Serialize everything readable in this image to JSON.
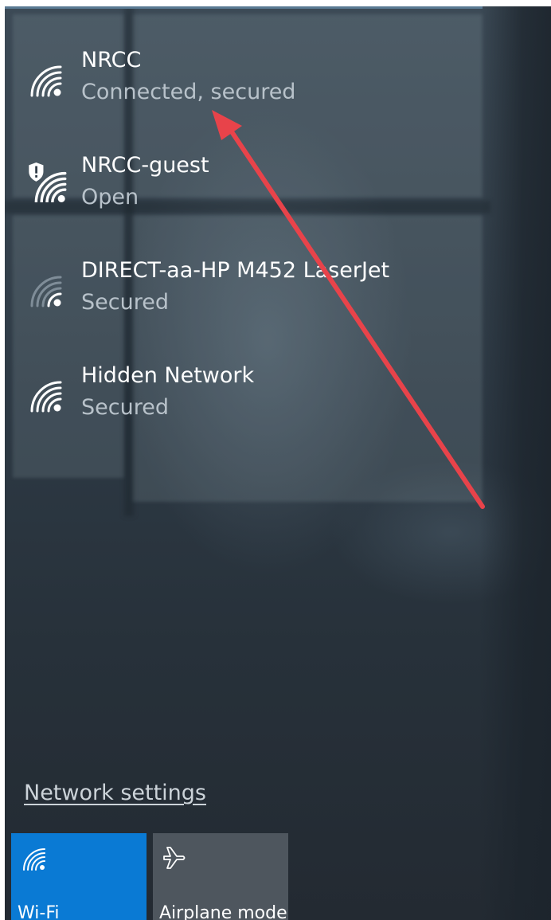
{
  "networks": [
    {
      "name": "NRCC",
      "status": "Connected, secured",
      "icon": "wifi-signal-icon"
    },
    {
      "name": "NRCC-guest",
      "status": "Open",
      "icon": "wifi-open-warning-icon"
    },
    {
      "name": "DIRECT-aa-HP M452 LaserJet",
      "status": "Secured",
      "icon": "wifi-weak-signal-icon"
    },
    {
      "name": "Hidden Network",
      "status": "Secured",
      "icon": "wifi-signal-icon"
    }
  ],
  "settings_link": "Network settings",
  "quick_actions": [
    {
      "label": "Wi-Fi",
      "icon": "wifi-icon",
      "active": true,
      "color": "#0a7ad4"
    },
    {
      "label": "Airplane mode",
      "icon": "airplane-icon",
      "active": false,
      "color": "#4e565e"
    }
  ],
  "annotation": {
    "type": "arrow",
    "color": "#e8434a"
  }
}
